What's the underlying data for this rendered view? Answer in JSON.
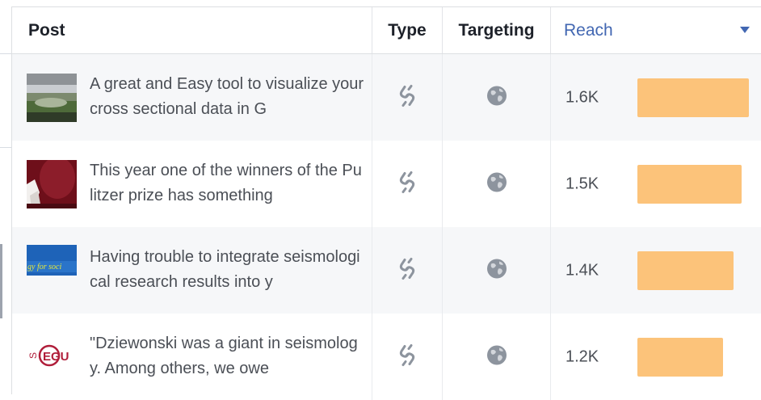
{
  "header": {
    "post": "Post",
    "type": "Type",
    "targeting": "Targeting",
    "reach": "Reach"
  },
  "colors": {
    "reach_bar": "#fcc37a",
    "link_accent": "#4267b2"
  },
  "rows": [
    {
      "text": "A great and Easy tool to visualize your cross sectional data in G",
      "type_icon": "link-icon",
      "targeting_icon": "globe-icon",
      "reach": "1.6K",
      "reach_fraction": 1.0,
      "thumbnail": "landscape-photo"
    },
    {
      "text": "This year one of the winners of the Pulitzer prize has something",
      "type_icon": "link-icon",
      "targeting_icon": "globe-icon",
      "reach": "1.5K",
      "reach_fraction": 0.937,
      "thumbnail": "red-figure-photo"
    },
    {
      "text": "Having trouble to integrate seismological research results into y",
      "type_icon": "link-icon",
      "targeting_icon": "globe-icon",
      "reach": "1.4K",
      "reach_fraction": 0.86,
      "thumbnail": "blue-banner",
      "thumbnail_text": "gy for soci"
    },
    {
      "text": "\"Dziewonski was a giant in seismology. Among others, we owe",
      "type_icon": "link-icon",
      "targeting_icon": "globe-icon",
      "reach": "1.2K",
      "reach_fraction": 0.765,
      "thumbnail": "egu-logo",
      "thumbnail_text": "EGU"
    }
  ]
}
